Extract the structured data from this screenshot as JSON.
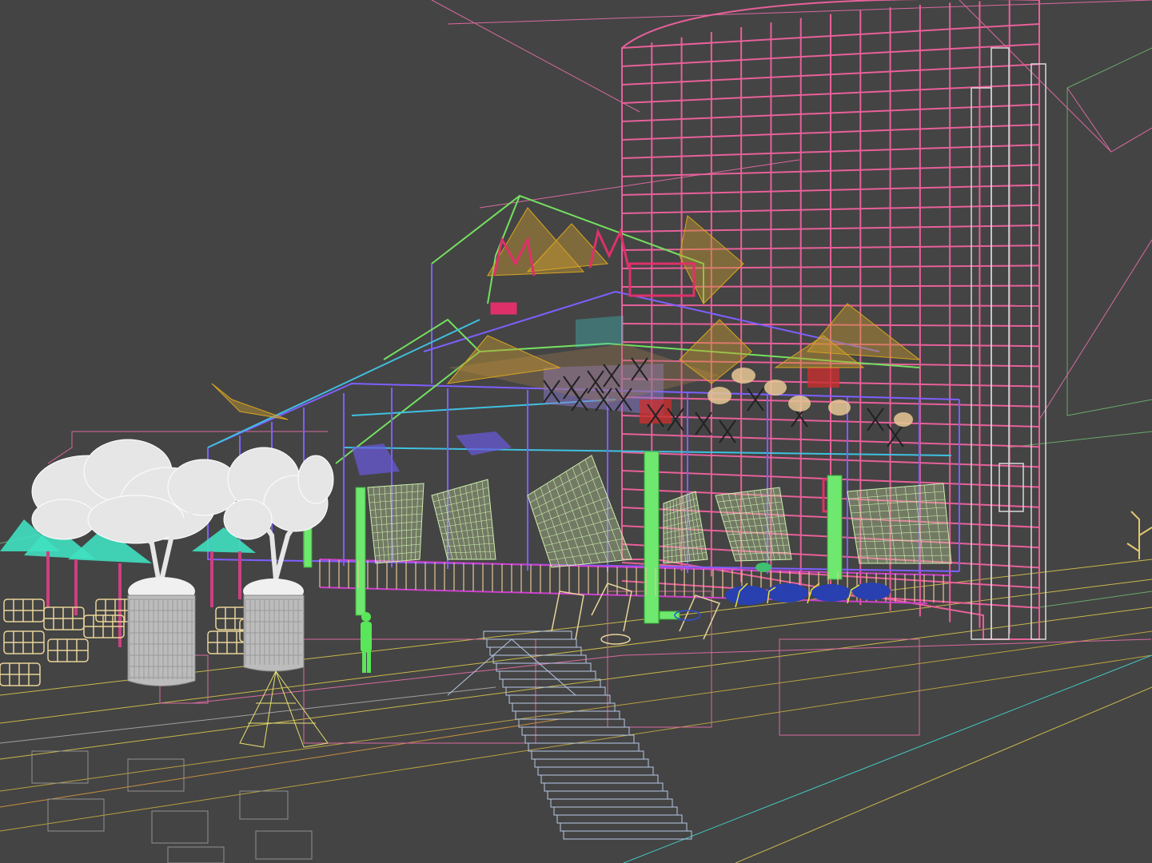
{
  "viewport": {
    "background": "#444444",
    "render_mode": "wireframe"
  },
  "scene": {
    "objects": [
      {
        "name": "tower",
        "color": "#e8609a"
      },
      {
        "name": "pavilion-frame",
        "color": "#7f5fff"
      },
      {
        "name": "sail-canopies",
        "color": "#d9a520"
      },
      {
        "name": "signage",
        "color": "#e0306a"
      },
      {
        "name": "trees",
        "color": "#e6e6e6"
      },
      {
        "name": "planters",
        "color": "#cfcfcf"
      },
      {
        "name": "patio-umbrellas",
        "color": "#40e0c0"
      },
      {
        "name": "lounge-chairs",
        "color": "#e8d49a"
      },
      {
        "name": "cargo-nets",
        "color": "#c8e0a0"
      },
      {
        "name": "green-columns",
        "color": "#6ee86e"
      },
      {
        "name": "stairs",
        "color": "#b8c8e8"
      },
      {
        "name": "human-figure",
        "color": "#5ae65a"
      },
      {
        "name": "ground-grid",
        "color": "#c8b84a"
      },
      {
        "name": "far-buildings",
        "color": "#6aa86a"
      },
      {
        "name": "plants",
        "color": "#3050d0"
      }
    ]
  }
}
